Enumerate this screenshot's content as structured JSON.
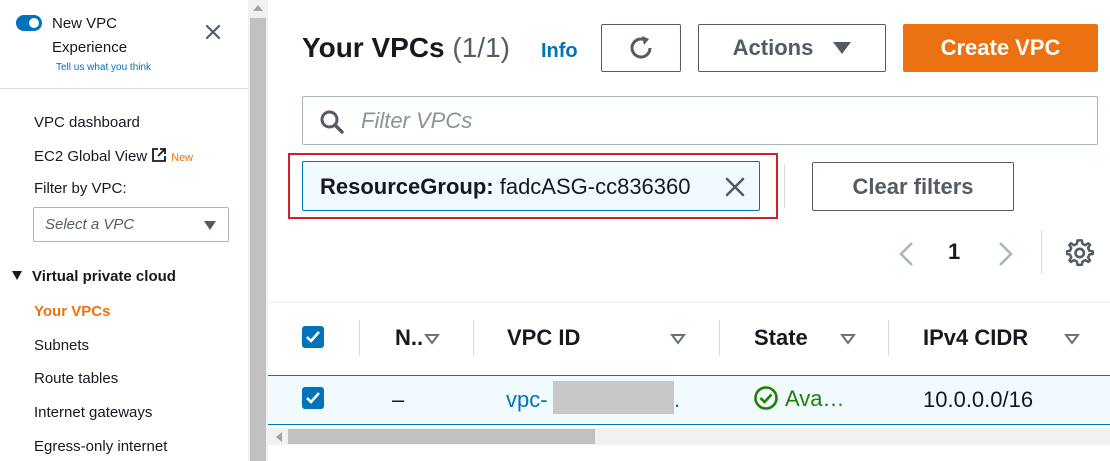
{
  "sidebar": {
    "toggle_title": "New VPC Experience",
    "feedback_link": "Tell us what you think",
    "nav": {
      "dashboard": "VPC dashboard",
      "ec2_global_view": "EC2 Global View",
      "new_badge": "New",
      "filter_label": "Filter by VPC:",
      "select_placeholder": "Select a VPC",
      "section_title": "Virtual private cloud",
      "items": [
        "Your VPCs",
        "Subnets",
        "Route tables",
        "Internet gateways",
        "Egress-only internet"
      ]
    }
  },
  "header": {
    "title": "Your VPCs",
    "count": "(1/1)",
    "info": "Info",
    "actions_label": "Actions",
    "create_label": "Create VPC"
  },
  "search": {
    "placeholder": "Filter VPCs"
  },
  "filter": {
    "token_key": "ResourceGroup:",
    "token_value": "fadcASG-cc836360",
    "clear_label": "Clear filters"
  },
  "pagination": {
    "current_page": "1"
  },
  "table": {
    "columns": [
      "N..",
      "VPC ID",
      "State",
      "IPv4 CIDR"
    ],
    "rows": [
      {
        "name": "–",
        "vpc_id": "vpc-",
        "vpc_id_suffix": ".",
        "state": "Ava…",
        "ipv4_cidr": "10.0.0.0/16",
        "selected": true
      }
    ]
  },
  "colors": {
    "accent": "#0073bb",
    "brand_orange": "#ec7211",
    "status_green": "#1d8102",
    "highlight_red": "#d1202b"
  },
  "icons": [
    "close-icon",
    "external-link-icon",
    "refresh-icon",
    "search-icon",
    "settings-icon",
    "status-available-icon"
  ]
}
